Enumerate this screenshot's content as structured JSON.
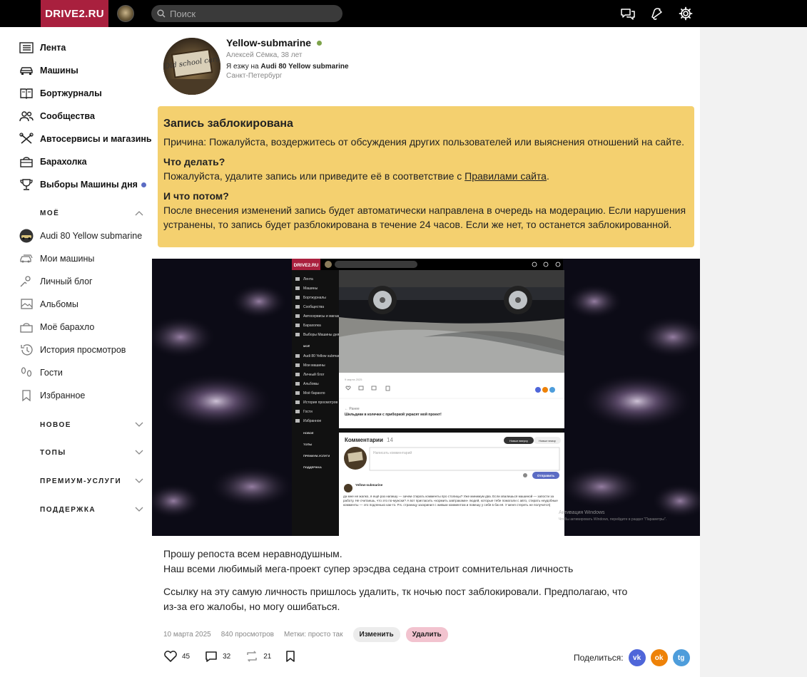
{
  "header": {
    "logo": "DRIVE2.RU",
    "search_placeholder": "Поиск"
  },
  "sidebar": {
    "main_items": [
      {
        "label": "Лента",
        "icon": "feed-icon"
      },
      {
        "label": "Машины",
        "icon": "car-icon"
      },
      {
        "label": "Бортжурналы",
        "icon": "logbook-icon"
      },
      {
        "label": "Сообщества",
        "icon": "community-icon"
      },
      {
        "label": "Автосервисы и магазины",
        "icon": "tools-icon"
      },
      {
        "label": "Барахолка",
        "icon": "market-icon"
      },
      {
        "label": "Выборы Машины дня",
        "icon": "trophy-icon"
      }
    ],
    "moe_title": "МОЁ",
    "moe_items": [
      {
        "label": "Audi 80 Yellow submarine",
        "icon": "car-avatar-icon"
      },
      {
        "label": "Мои машины",
        "icon": "my-cars-icon"
      },
      {
        "label": "Личный блог",
        "icon": "blog-icon"
      },
      {
        "label": "Альбомы",
        "icon": "album-icon"
      },
      {
        "label": "Моё барахло",
        "icon": "my-stuff-icon"
      },
      {
        "label": "История просмотров",
        "icon": "history-icon"
      },
      {
        "label": "Гости",
        "icon": "footprints-icon"
      },
      {
        "label": "Избранное",
        "icon": "bookmark-icon"
      }
    ],
    "sections": [
      "НОВОЕ",
      "ТОПЫ",
      "ПРЕМИУМ-УСЛУГИ",
      "ПОДДЕРЖКА"
    ]
  },
  "profile": {
    "name": "Yellow-submarine",
    "subtitle": "Алексей Сёмка, 38 лет",
    "car_prefix": "Я езжу на",
    "car": "Audi 80 Yellow submarine",
    "city": "Санкт-Петербург",
    "avatar_text": "Old school cars"
  },
  "blocked": {
    "title": "Запись заблокирована",
    "reason": "Причина: Пожалуйста, воздержитесь от обсуждения других пользователей или выяснения отношений на сайте.",
    "what_title": "Что делать?",
    "what_text": "Пожалуйста, удалите запись или приведите её в соответствие с",
    "rules_link": "Правилами сайта",
    "then_title": "И что потом?",
    "then_text": "После внесения изменений запись будет автоматически направлена в очередь на модерацию. Если нарушения устранены, то запись будет разблокирована в течение 24 часов. Если же нет, то останется заблокированной."
  },
  "embedded": {
    "logo": "DRIVE2.RU",
    "nav": [
      "Лента",
      "Машины",
      "Бортжурналы",
      "Сообщества",
      "Автосервисы и магазины",
      "Барахолка",
      "Выборы Машины дня"
    ],
    "moe_title": "МОЁ",
    "moe": [
      "Audi 80 Yellow submarine",
      "Мои машины",
      "Личный блог",
      "Альбомы",
      "Моё барахло",
      "История просмотров",
      "Гости",
      "Избранное"
    ],
    "sections": [
      "НОВОЕ",
      "ТОПЫ",
      "ПРЕМИУМ-УСЛУГИ",
      "ПОДДЕРЖКА"
    ],
    "meta": "9 марта 2025",
    "prev_label": "← Ранее",
    "prev_title": "Шильдики в колечки с приборкой украсят мой проект!",
    "comments_title": "Комментарии",
    "comments_count": "14",
    "sort_new": "Новые вверху",
    "sort_old": "Новые внизу",
    "comment_placeholder": "Написать комментарий",
    "send": "Отправить",
    "commenter": "Yellow-submarine",
    "comment_text": "да мне не жалко, я ещё раз напишу — зачем стирать комменты про столицы? Уже минимум два. Если хвалишься машиной — запости за работу. Не считаешь, что это по-мужски? А вот пригласить «кормить завтраками» людей, которые тебе помогали с авто, стирать неудобные комменты — это подленько как-то. P.s. страницу заскринил с живым комментом и повешу у себя в бж её. У меня стереть не получится)",
    "activation_title": "Активация Windows",
    "activation_text": "Чтобы активировать Windows, перейдите в раздел \"Параметры\"."
  },
  "post": {
    "p1_line1": "Прошу репоста всем неравнодушным.",
    "p1_line2": "Наш всеми любимый мега-проект супер эрэсдва седана строит сомнительная личность",
    "p2_line1": "Ссылку на эту самую личность пришлось удалить, тк ночью пост заблокировали. Предполагаю, что",
    "p2_line2": "из-за его жалобы, но могу ошибаться.",
    "date": "10 марта 2025",
    "views": "840 просмотров",
    "tags": "Метки: просто так",
    "edit": "Изменить",
    "delete": "Удалить",
    "likes": "45",
    "comments": "32",
    "reposts": "21",
    "share_label": "Поделиться:",
    "share_vk": "vk",
    "share_ok": "ok",
    "share_tg": "tg"
  },
  "colors": {
    "brand": "#a9203e",
    "blocked_bg": "#f4d06f",
    "online": "#7da34a",
    "vk": "#4f66d9",
    "ok": "#ee8208",
    "tg": "#4e9ddb"
  }
}
